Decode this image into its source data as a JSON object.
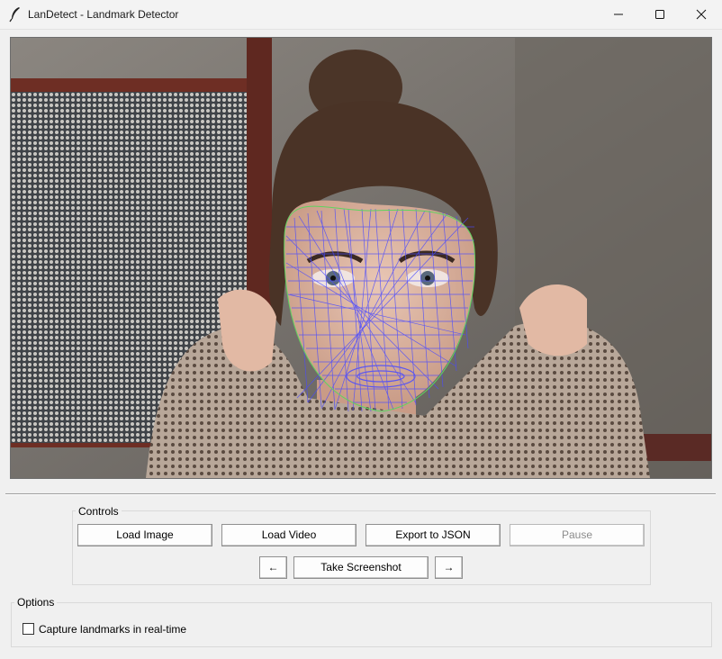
{
  "window": {
    "title": "LanDetect - Landmark Detector",
    "minimize_icon": "minimize-icon",
    "maximize_icon": "maximize-icon",
    "close_icon": "close-icon"
  },
  "canvas": {
    "content": "photo of woman with face landmark mesh overlay",
    "mesh_color": "#4a4aff",
    "outline_color": "#5fd35f"
  },
  "controls": {
    "group_label": "Controls",
    "load_image": "Load Image",
    "load_video": "Load Video",
    "export_json": "Export to JSON",
    "pause": "Pause",
    "prev": "←",
    "take_screenshot": "Take Screenshot",
    "next": "→"
  },
  "options": {
    "group_label": "Options",
    "realtime_label": "Capture landmarks in real-time",
    "realtime_checked": false
  }
}
